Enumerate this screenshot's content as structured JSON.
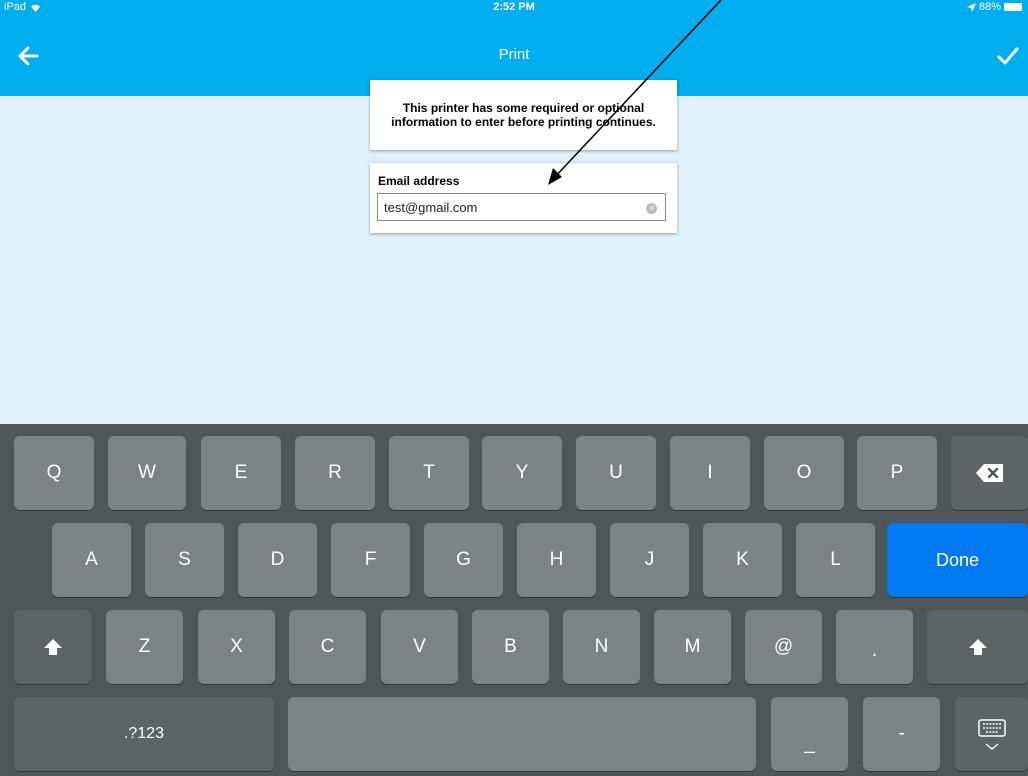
{
  "statusbar": {
    "carrier": "iPad",
    "time": "2:52 PM",
    "battery": "88%"
  },
  "navbar": {
    "title": "Print"
  },
  "info_card": {
    "text": "This printer has some required or optional information to enter before printing continues."
  },
  "email_card": {
    "label": "Email address",
    "value": "test@gmail.com"
  },
  "keyboard": {
    "row1": [
      "Q",
      "W",
      "E",
      "R",
      "T",
      "Y",
      "U",
      "I",
      "O",
      "P"
    ],
    "row2": [
      "A",
      "S",
      "D",
      "F",
      "G",
      "H",
      "J",
      "K",
      "L"
    ],
    "done_label": "Done",
    "row3": [
      "Z",
      "X",
      "C",
      "V",
      "B",
      "N",
      "M",
      "@",
      "."
    ],
    "mode_switch": ".?123",
    "underscore": "_",
    "dash": "-"
  },
  "colors": {
    "header": "#00adef",
    "background": "#dff0fb",
    "keyboard": "#4e5657",
    "key": "#7b8384",
    "done": "#0079f2"
  }
}
